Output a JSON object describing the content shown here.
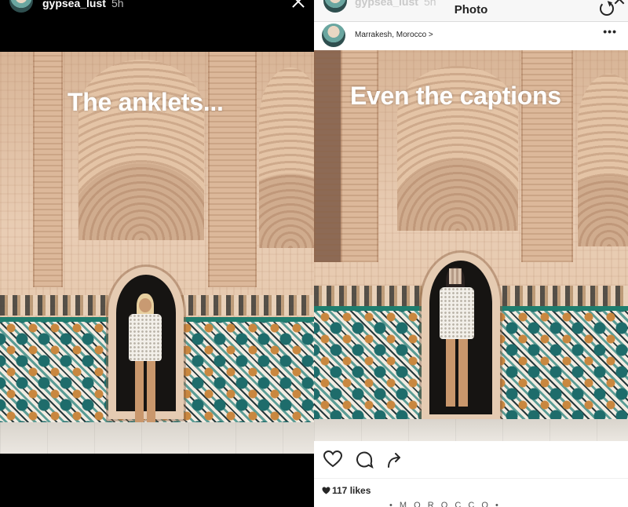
{
  "story": {
    "username": "gypsea_lust",
    "time": "5h",
    "overlay_text": "The anklets..."
  },
  "post": {
    "nav_username": "gypsea_lust",
    "nav_time": "5h",
    "title": "Photo",
    "location": "Marrakesh, Morocco",
    "location_chevron": ">",
    "more": "•••",
    "overlay_text": "Even the captions",
    "likes": "117 likes",
    "caption_peek": "• M O R O C C O •"
  },
  "icons": [
    "close-icon",
    "refresh-icon",
    "more-icon",
    "heart-icon",
    "comment-icon",
    "share-icon",
    "heart-filled-icon"
  ],
  "colors": {
    "story_bg": "#000000",
    "post_bg": "#ffffff",
    "tile_teal": "#1f7d6e",
    "wall": "#e3c7ad"
  }
}
